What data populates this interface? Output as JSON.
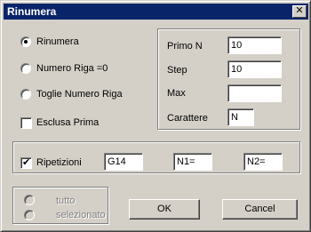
{
  "window": {
    "title": "Rinumera",
    "close_glyph": "✕"
  },
  "options": {
    "rinumera": {
      "label": "Rinumera",
      "checked": true
    },
    "numero_riga_zero": {
      "label": "Numero Riga =0",
      "checked": false
    },
    "togli_numero_riga": {
      "label": "Toglie Numero Riga",
      "checked": false
    },
    "esclusa_prima": {
      "label": "Esclusa Prima",
      "checked": false
    }
  },
  "params": {
    "primo_n": {
      "label": "Primo N",
      "value": "10"
    },
    "step": {
      "label": "Step",
      "value": "10"
    },
    "max": {
      "label": "Max",
      "value": ""
    },
    "carattere": {
      "label": "Carattere",
      "value": "N"
    }
  },
  "ripetizioni": {
    "label": "Ripetizioni",
    "checked": true,
    "field1": "G14",
    "field2": "N1=",
    "field3": "N2="
  },
  "scope": {
    "tutto": {
      "label": "tutto",
      "enabled": false
    },
    "selezionato": {
      "label": "selezionato",
      "enabled": false
    }
  },
  "buttons": {
    "ok": "OK",
    "cancel": "Cancel"
  },
  "colors": {
    "titlebar": "#0a246a",
    "face": "#d4d0c8",
    "disabled_text": "#808080"
  }
}
